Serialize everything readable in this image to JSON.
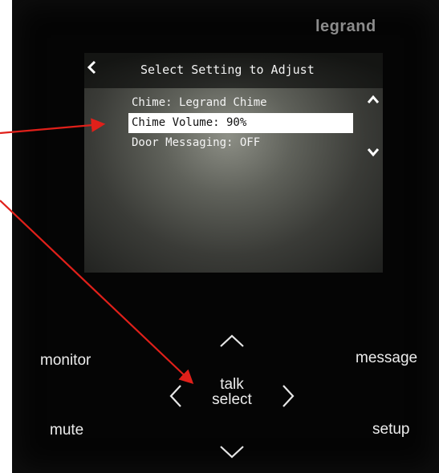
{
  "device": {
    "brand": "legrand",
    "background_color": "#050505",
    "label_color": "#ececec"
  },
  "screen": {
    "back_icon": "chevron-left-icon",
    "title": "Select Setting to Adjust",
    "items": [
      {
        "label": "Chime: Legrand Chime",
        "selected": false
      },
      {
        "label": "Chime Volume: 90%",
        "selected": true
      },
      {
        "label": "Door Messaging: OFF",
        "selected": false
      }
    ],
    "scroll_up_icon": "chevron-up-icon",
    "scroll_down_icon": "chevron-down-icon",
    "selection_color": "#ffffff"
  },
  "buttons": {
    "monitor": "monitor",
    "message": "message",
    "mute": "mute",
    "setup": "setup",
    "talk": "talk",
    "select": "select"
  },
  "annotations": {
    "arrow_color": "#e0201a",
    "arrows": [
      "arrow-to-chime-volume",
      "arrow-to-talk-select"
    ]
  }
}
